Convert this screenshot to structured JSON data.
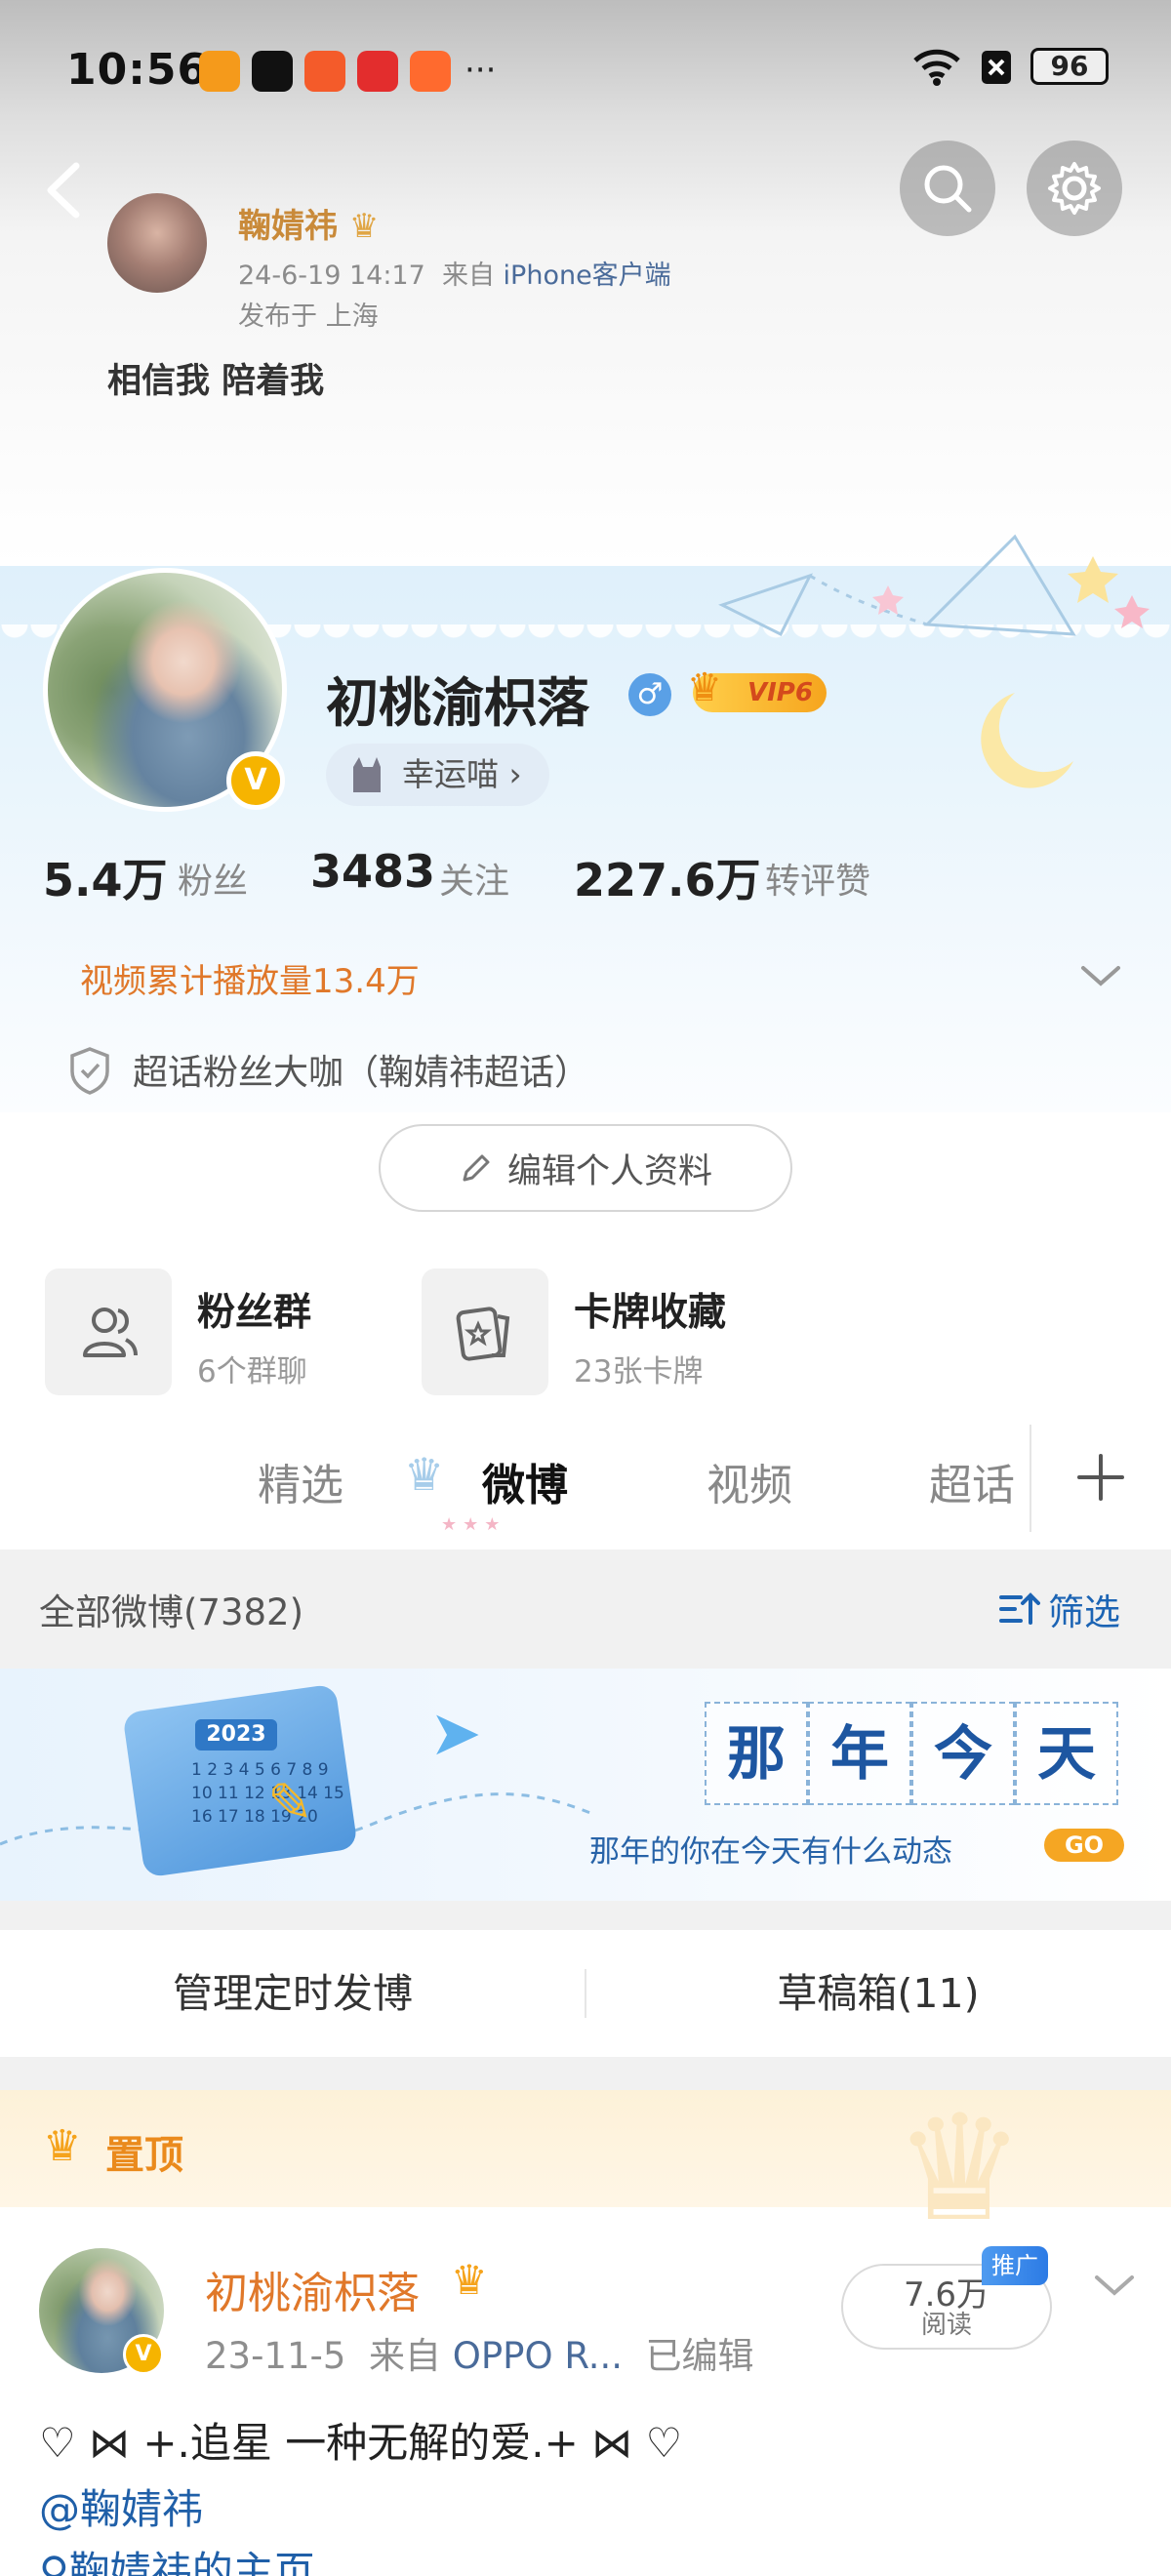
{
  "status_bar": {
    "time": "10:56",
    "more": "···",
    "battery": "96",
    "app_icons": [
      "hearts-app-icon",
      "dewu-app-icon",
      "kuaishou-app-icon",
      "pinduoduo-app-icon",
      "kuaishou-speed-app-icon"
    ]
  },
  "background_post": {
    "author": "鞠婧祎",
    "date": "24-6-19 14:17",
    "source_prefix": "来自",
    "source_device": "iPhone客户端",
    "location": "发布于 上海",
    "text": "相信我 陪着我"
  },
  "profile": {
    "name": "初桃渝枳落",
    "gender_symbol": "♂",
    "vip_label": "VIP6",
    "lucky_label": "幸运喵 ›",
    "verify_mark": "V",
    "stats": {
      "fans_value": "5.4万",
      "fans_label": "粉丝",
      "following_value": "3483",
      "following_label": "关注",
      "likes_value": "227.6万",
      "likes_label": "转评赞"
    },
    "video_stat": "视频累计播放量13.4万",
    "fan_badge": "超话粉丝大咖（鞠婧祎超话）",
    "edit_button": "编辑个人资料"
  },
  "quick_cards": [
    {
      "title": "粉丝群",
      "sub": "6个群聊"
    },
    {
      "title": "卡牌收藏",
      "sub": "23张卡牌"
    }
  ],
  "tabs": [
    "精选",
    "微博",
    "视频",
    "超话"
  ],
  "tab_dots": "★★★",
  "weibo_list": {
    "all_label": "全部微博(7382)",
    "filter_label": "筛选"
  },
  "banner": {
    "year": "2023",
    "calendar_numbers": "1 2 3 4 5 6 7 8 9 10 11 12 13 14 15 16 17 18 19 20",
    "chars": [
      "那",
      "年",
      "今",
      "天"
    ],
    "subtitle": "那年的你在今天有什么动态",
    "go_label": "GO"
  },
  "actions": {
    "scheduled": "管理定时发博",
    "drafts": "草稿箱(11)"
  },
  "pinned": {
    "label": "置顶"
  },
  "post": {
    "author": "初桃渝枳落",
    "date": "23-11-5",
    "source_prefix": "来自",
    "source_device": "OPPO R...",
    "edited": "已编辑",
    "reads_value": "7.6万",
    "reads_label": "阅读",
    "promo_tag": "推广",
    "verify_mark": "V",
    "line1": "♡ ⋈ +.追星 一种无解的爱.+ ⋈ ♡",
    "line2": "@鞠婧祎",
    "line3": "鞠婧祎的主页"
  },
  "colors": {
    "accent_blue": "#1c64b4",
    "orange": "#e0782a",
    "verify_gold": "#f6b400"
  }
}
